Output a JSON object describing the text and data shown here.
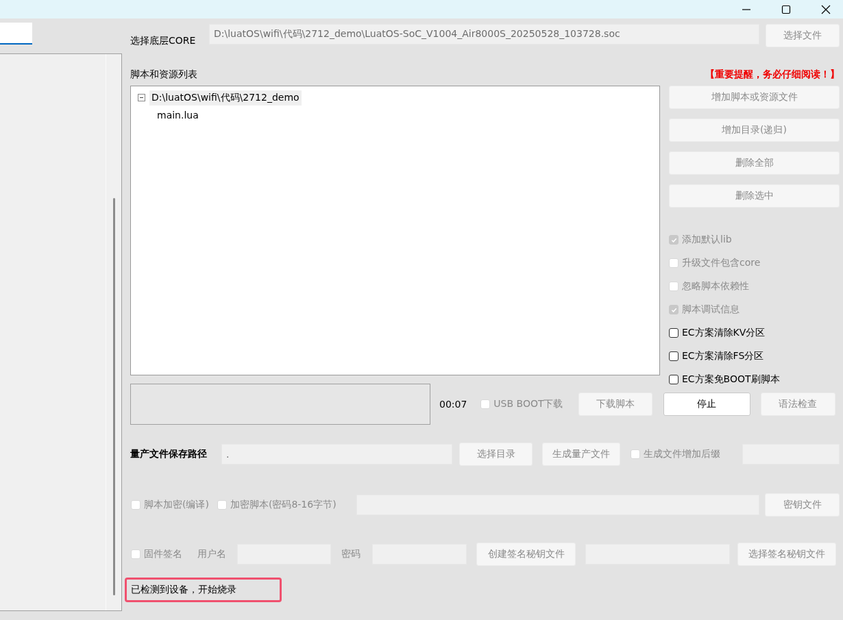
{
  "core": {
    "label": "选择底层CORE",
    "value": "D:\\luatOS\\wifi\\代码\\2712_demo\\LuatOS-SoC_V1004_Air8000S_20250528_103728.soc",
    "button": {
      "label": "选择文件",
      "disabled": true
    }
  },
  "resources": {
    "label": "脚本和资源列表",
    "notice": "【重要提醒，务必仔细阅读！】",
    "tree": [
      {
        "label": "D:\\luatOS\\wifi\\代码\\2712_demo",
        "expanded": true,
        "selected": true,
        "children": [
          {
            "label": "main.lua",
            "selected": false
          }
        ]
      }
    ]
  },
  "side_buttons": [
    {
      "label": "增加脚本或资源文件",
      "disabled": true
    },
    {
      "label": "增加目录(递归)",
      "disabled": true
    },
    {
      "label": "删除全部",
      "disabled": true
    },
    {
      "label": "删除选中",
      "disabled": true
    }
  ],
  "options": [
    {
      "label": "添加默认lib",
      "checked": true,
      "disabled": true
    },
    {
      "label": "升级文件包含core",
      "checked": false,
      "disabled": true
    },
    {
      "label": "忽略脚本依赖性",
      "checked": false,
      "disabled": true
    },
    {
      "label": "脚本调试信息",
      "checked": true,
      "disabled": true
    },
    {
      "label": "EC方案清除KV分区",
      "checked": false,
      "disabled": false
    },
    {
      "label": "EC方案清除FS分区",
      "checked": false,
      "disabled": false
    },
    {
      "label": "EC方案免BOOT刷脚本",
      "checked": false,
      "disabled": false
    }
  ],
  "download": {
    "timer": "00:07",
    "usb_boot": {
      "label": "USB BOOT下载",
      "checked": false,
      "disabled": true
    },
    "buttons": [
      {
        "label": "下载脚本",
        "disabled": true
      },
      {
        "label": "停止",
        "disabled": false
      },
      {
        "label": "语法检查",
        "disabled": true
      }
    ]
  },
  "mass_production": {
    "label": "量产文件保存路径",
    "value": ".",
    "buttons": [
      {
        "label": "选择目录",
        "disabled": true
      },
      {
        "label": "生成量产文件",
        "disabled": true
      }
    ],
    "suffix": {
      "label": "生成文件增加后缀",
      "checked": false,
      "disabled": true
    }
  },
  "encryption": {
    "options": [
      {
        "label": "脚本加密(编译)",
        "checked": false,
        "disabled": true
      },
      {
        "label": "加密脚本(密码8-16字节)",
        "checked": false,
        "disabled": true
      }
    ],
    "button": {
      "label": "密钥文件",
      "disabled": true
    }
  },
  "signing": {
    "checkbox": {
      "label": "固件签名",
      "checked": false,
      "disabled": true
    },
    "username_label": "用户名",
    "password_label": "密码",
    "buttons": [
      {
        "label": "创建签名秘钥文件",
        "disabled": true
      },
      {
        "label": "选择签名秘钥文件",
        "disabled": true
      }
    ]
  },
  "status": "已检测到设备，开始烧录"
}
